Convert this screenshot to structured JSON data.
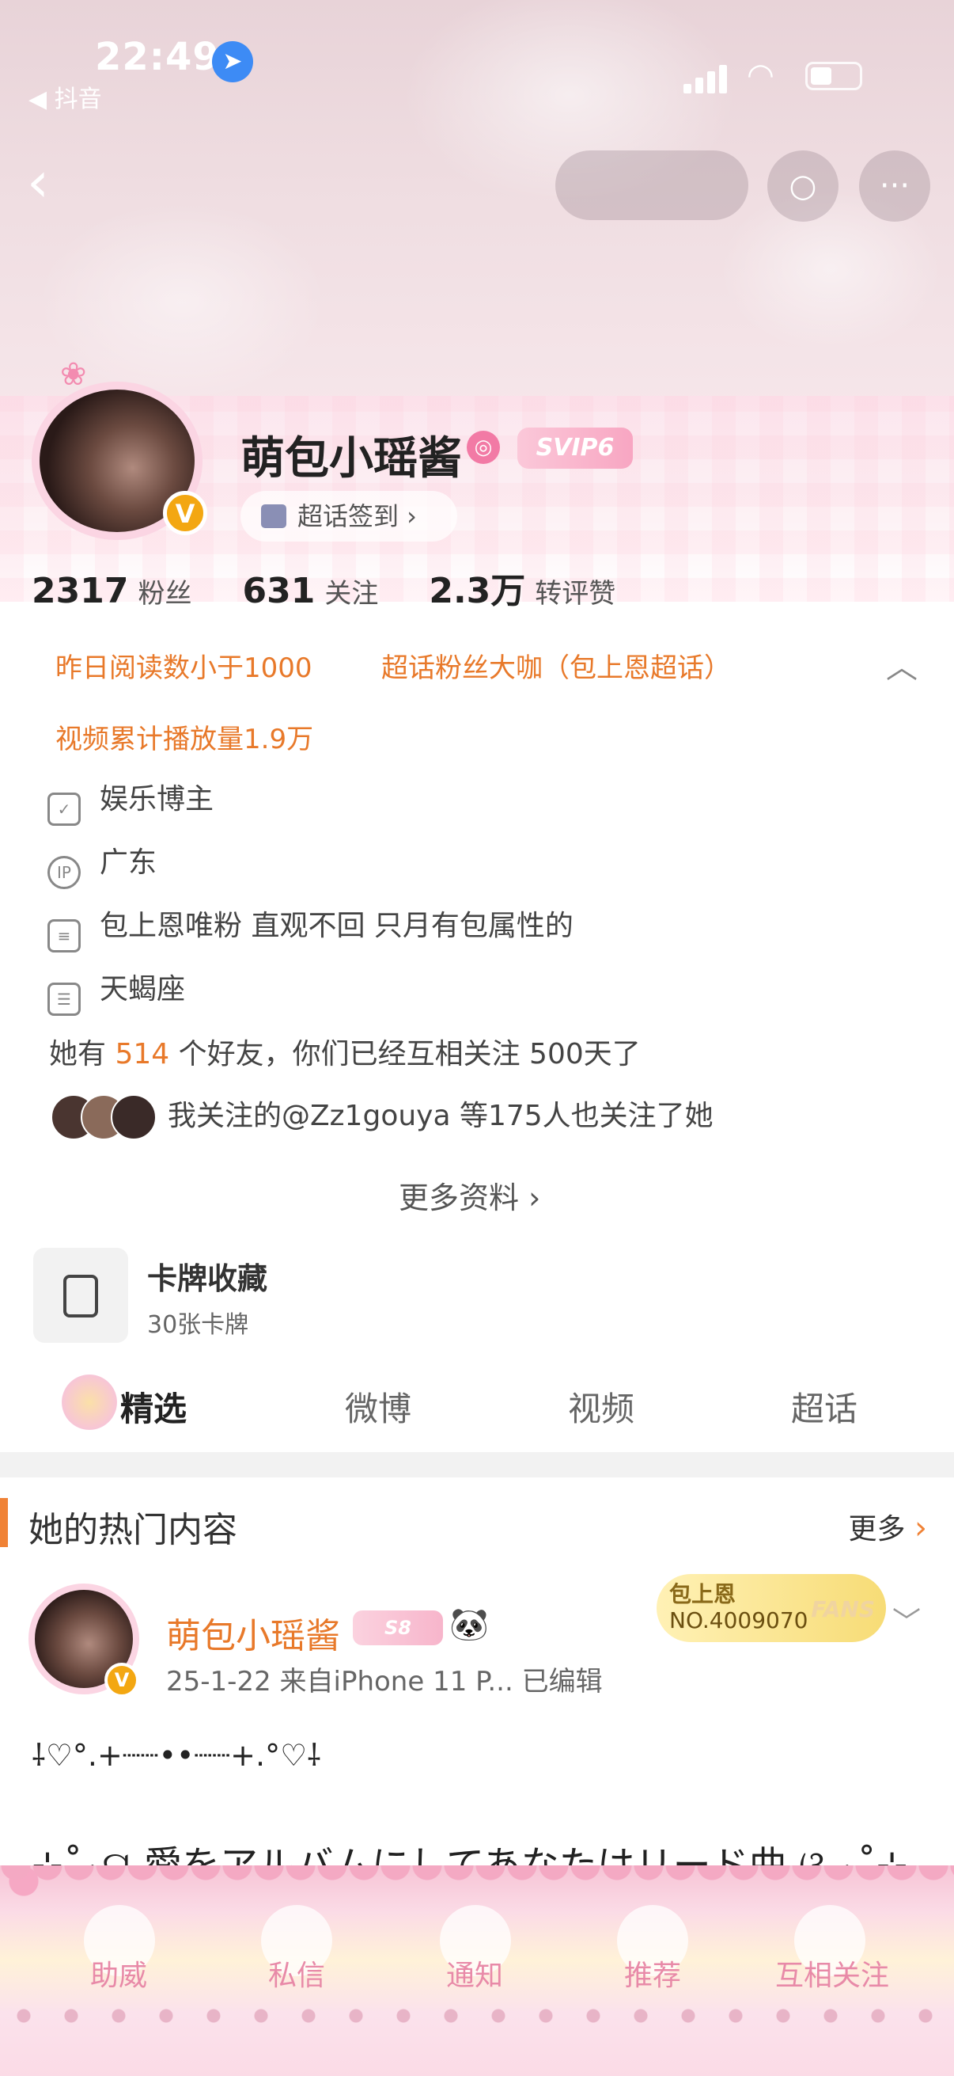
{
  "status_bar": {
    "time": "22:49",
    "back_app": "◀ 抖音"
  },
  "profile": {
    "name": "萌包小瑶酱",
    "vip_badge": "SVIP6",
    "checkin_label": "超话签到 ›",
    "stats": [
      {
        "value": "2317",
        "label": "粉丝"
      },
      {
        "value": "631",
        "label": "关注"
      },
      {
        "value": "2.3万",
        "label": "转评赞"
      }
    ],
    "tags": [
      "昨日阅读数小于1000",
      "超话粉丝大咖（包上恩超话）",
      "视频累计播放量1.9万"
    ],
    "info": [
      {
        "icon": "shield-icon",
        "glyph": "✓",
        "text": "娱乐博主"
      },
      {
        "icon": "ip-icon",
        "glyph": "IP",
        "text": "广东"
      },
      {
        "icon": "document-icon",
        "glyph": "≡",
        "text": "包上恩唯粉 直观不回 只月有包属性的"
      },
      {
        "icon": "calendar-icon",
        "glyph": "☰",
        "text": "天蝎座"
      }
    ],
    "friends": {
      "prefix": "她有 ",
      "count": "514",
      "suffix": " 个好友，你们已经互相关注 500天了"
    },
    "mutual_follow": "我关注的@Zz1gouya 等175人也关注了她",
    "more_info": "更多资料 ›"
  },
  "card_collection": {
    "title": "卡牌收藏",
    "subtitle": "30张卡牌"
  },
  "tabs": [
    "精选",
    "微博",
    "视频",
    "超话"
  ],
  "hot_section": {
    "title": "她的热门内容",
    "more": "更多"
  },
  "post": {
    "author": "萌包小瑶酱",
    "level_badge": "S8",
    "emoji": "🐼",
    "meta": "25-1-22  来自iPhone 11 P...  已编辑",
    "fans_badge": {
      "name": "包上恩",
      "number": "NO.4009070",
      "fans": "FANS"
    },
    "text_line1": "⸸♡°.+┈┈•︎•┈┈+.°♡⸸",
    "text_line2": "⊹˚₊ଘ 愛をアルバムにしてあなたはリード曲 ଓ ₊˚⊹"
  },
  "bottom_nav": [
    "助威",
    "私信",
    "通知",
    "推荐",
    "互相关注"
  ],
  "colors": {
    "accent": "#e8792a",
    "pink": "#f7c5d7",
    "link_orange": "#f08236"
  }
}
